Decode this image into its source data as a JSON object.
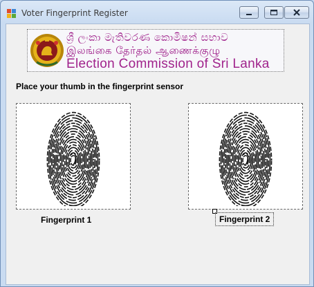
{
  "window": {
    "title": "Voter Fingerprint Register",
    "minimize_label": "Minimize",
    "maximize_label": "Maximize",
    "close_label": "Close"
  },
  "banner": {
    "line_sinhala": "ශ්‍රී ලංකා මැතිවරණ කොමිෂන් සභාව",
    "line_tamil": "இலங்கை தேர்தல் ஆணைக்குழு",
    "line_english": "Election Commission of Sri Lanka",
    "color": "#a0238c"
  },
  "instruction": "Place your thumb in the fingerprint sensor",
  "fingerprints": [
    {
      "label": "Fingerprint 1",
      "icon": "fingerprint-icon"
    },
    {
      "label": "Fingerprint 2",
      "icon": "fingerprint-icon"
    }
  ]
}
